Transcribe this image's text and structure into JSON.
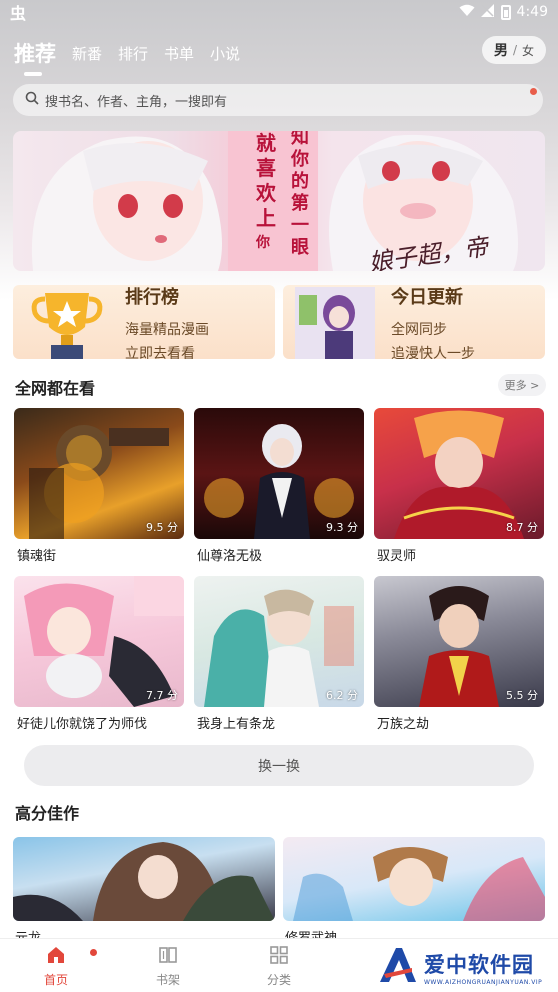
{
  "status_bar": {
    "carrier_icon": "虫",
    "time": "4:49",
    "icons": [
      "wifi-icon",
      "signal-icon",
      "battery-icon"
    ]
  },
  "nav": {
    "tabs": [
      {
        "label": "推荐",
        "active": true
      },
      {
        "label": "新番",
        "active": false
      },
      {
        "label": "排行",
        "active": false
      },
      {
        "label": "书单",
        "active": false
      },
      {
        "label": "小说",
        "active": false
      }
    ],
    "gender": {
      "male": "男",
      "sep": "/",
      "female": "女"
    }
  },
  "search": {
    "placeholder": "搜书名、作者、主角，一搜即有"
  },
  "banner": {
    "text_col_1": [
      "就",
      "喜",
      "欢",
      "上",
      "你"
    ],
    "text_col_2": [
      "知",
      "你",
      "的",
      "第",
      "一",
      "眼"
    ],
    "signature": "娘子超，帝"
  },
  "promo": [
    {
      "title": "排行榜",
      "lines": [
        "海量精品漫画",
        "立即去看看"
      ]
    },
    {
      "title": "今日更新",
      "lines": [
        "全网同步",
        "追漫快人一步"
      ]
    }
  ],
  "sections": {
    "trending": {
      "title": "全网都在看",
      "more": "更多 >",
      "items": [
        {
          "title": "镇魂街",
          "score": "9.5 分"
        },
        {
          "title": "仙尊洛无极",
          "score": "9.3 分"
        },
        {
          "title": "驭灵师",
          "score": "8.7 分"
        },
        {
          "title": "好徒儿你就饶了为师伐",
          "score": "7.7 分"
        },
        {
          "title": "我身上有条龙",
          "score": "6.2 分"
        },
        {
          "title": "万族之劫",
          "score": "5.5 分"
        }
      ],
      "refresh": "换一换"
    },
    "top_rated": {
      "title": "高分佳作",
      "items": [
        {
          "title": "元龙"
        },
        {
          "title": "修罗武神"
        }
      ]
    }
  },
  "tab_bar": {
    "items": [
      {
        "label": "首页",
        "icon": "home-icon",
        "active": true
      },
      {
        "label": "书架",
        "icon": "bookshelf-icon",
        "active": false
      },
      {
        "label": "分类",
        "icon": "category-icon",
        "active": false
      }
    ]
  },
  "watermark": {
    "main": "爱中软件园",
    "sub": "WWW.AIZHONGRUANJIANYUAN.VIP"
  },
  "colors": {
    "accent": "#e2473b",
    "promo_bg": "#fbe0c9",
    "brand_blue": "#1f4aa8"
  }
}
